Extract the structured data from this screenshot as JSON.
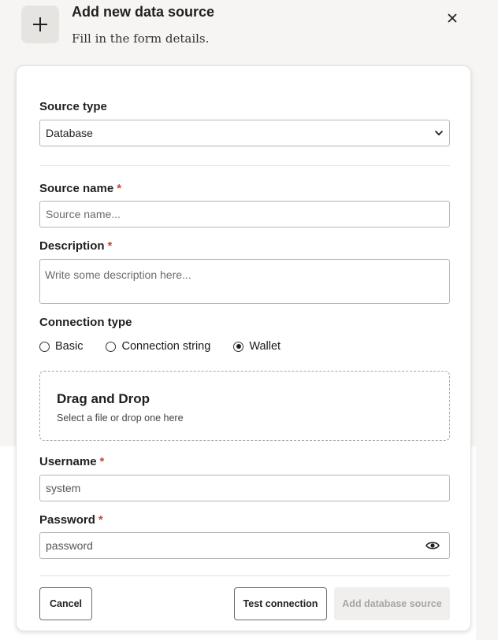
{
  "header": {
    "title": "Add new data source",
    "subtitle": "Fill in the form details.",
    "icon": "plus-icon",
    "close_icon": "close-icon"
  },
  "form": {
    "source_type": {
      "label": "Source type",
      "value": "Database",
      "icon": "chevron-down-icon"
    },
    "source_name": {
      "label": "Source name",
      "required_mark": "*",
      "placeholder": "Source name..."
    },
    "description": {
      "label": "Description",
      "required_mark": "*",
      "placeholder": "Write some description here..."
    },
    "connection_type": {
      "label": "Connection type",
      "options": [
        "Basic",
        "Connection string",
        "Wallet"
      ],
      "selected": "Wallet"
    },
    "dropzone": {
      "title": "Drag and Drop",
      "subtitle": "Select a file or drop one here"
    },
    "username": {
      "label": "Username",
      "required_mark": "*",
      "value": "system"
    },
    "password": {
      "label": "Password",
      "required_mark": "*",
      "value": "password",
      "icon": "eye-icon"
    }
  },
  "actions": {
    "cancel": "Cancel",
    "test": "Test connection",
    "add": "Add database source"
  },
  "colors": {
    "required": "#c74634",
    "background": "#f6f5f3",
    "disabled_button": "#f1efed"
  }
}
